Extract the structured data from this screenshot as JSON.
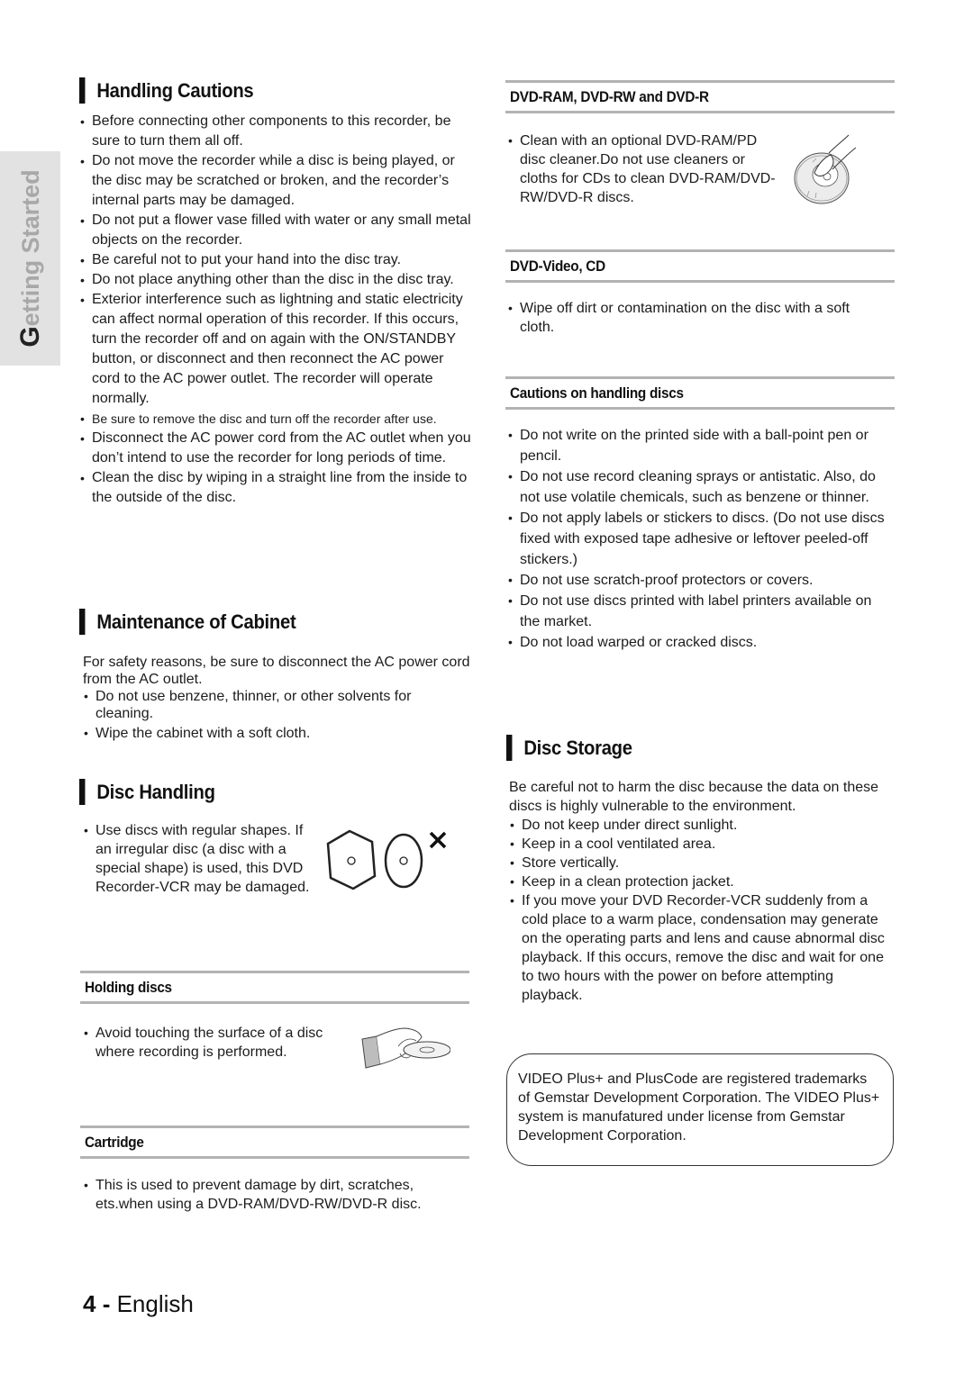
{
  "side_tab": {
    "initial": "G",
    "rest": "etting Started"
  },
  "left": {
    "handling_cautions": {
      "title": "Handling Cautions",
      "items": [
        "Before connecting other components to this recorder, be sure to turn them all off.",
        "Do not move the recorder while a disc is being played, or the disc may be scratched or broken, and the recorder’s internal parts may be damaged.",
        "Do not put a flower vase filled with water or any small metal objects on the recorder.",
        "Be careful not to put your hand into the disc tray.",
        "Do not place anything other than the disc in the disc tray.",
        "Exterior interference such as lightning and static electricity can affect normal operation of this recorder. If this occurs, turn the recorder off and on again with the ON/STANDBY button, or disconnect and then reconnect the AC power cord to the AC power outlet. The recorder will operate normally.",
        "Be sure to remove the disc and turn off the recorder after use.",
        "Disconnect the AC power cord from the AC outlet when you don’t intend to use the recorder for long periods of time.",
        "Clean the disc by wiping in a straight line from the inside to the outside of the disc."
      ]
    },
    "maintenance": {
      "title": "Maintenance of Cabinet",
      "intro": "For safety reasons, be sure to disconnect the AC power cord from the AC outlet.",
      "items": [
        "Do not use benzene, thinner, or other solvents for cleaning.",
        "Wipe the cabinet with a soft cloth."
      ]
    },
    "disc_handling": {
      "title": "Disc Handling",
      "item": "Use discs with regular shapes. If an irregular disc (a disc with a special shape) is used, this DVD Recorder-VCR may be damaged.",
      "illustration": [
        "hexagon-disc-icon",
        "oval-disc-icon",
        "not-allowed-x-icon"
      ]
    },
    "holding_discs": {
      "title": "Holding discs",
      "item": "Avoid touching the surface of a disc where recording is performed.",
      "illustration": "hand-holding-disc-icon"
    },
    "cartridge": {
      "title": "Cartridge",
      "item": "This is used to prevent damage by dirt, scratches, ets.when using a DVD-RAM/DVD-RW/DVD-R disc."
    }
  },
  "right": {
    "dvd_ram": {
      "title": "DVD-RAM, DVD-RW and DVD-R",
      "item": "Clean with an optional DVD-RAM/PD disc cleaner.Do not use cleaners or cloths for CDs to clean DVD-RAM/DVD-RW/DVD-R discs.",
      "illustration": "hand-cleaning-disc-icon"
    },
    "dvd_video": {
      "title": "DVD-Video, CD",
      "item": "Wipe off dirt or contamination on the disc with a soft cloth."
    },
    "cautions_discs": {
      "title": "Cautions on handling discs",
      "items": [
        "Do not write on the printed side with a ball-point pen or pencil.",
        "Do not use record cleaning sprays or antistatic. Also, do not use volatile chemicals, such as benzene or thinner.",
        "Do not apply labels or stickers to discs. (Do not use discs fixed with exposed tape adhesive or leftover peeled-off stickers.)",
        "Do not use scratch-proof protectors or covers.",
        "Do not use discs printed with label printers available on the market.",
        "Do not load warped or cracked discs."
      ]
    },
    "disc_storage": {
      "title": "Disc Storage",
      "intro": "Be careful not to harm the disc because the data on these discs is highly vulnerable to the environment.",
      "items": [
        "Do not keep under direct sunlight.",
        "Keep in a cool ventilated area.",
        "Store vertically.",
        "Keep in a clean protection jacket.",
        "If you move your DVD Recorder-VCR suddenly from a cold place to a warm place, condensation may generate on the operating parts and lens and cause abnormal disc playback. If this occurs, remove the disc and wait for one to two hours with the power on before attempting playback."
      ]
    },
    "trademark_note": "VIDEO Plus+ and PlusCode are registered trademarks of Gemstar Development Corporation. The VIDEO Plus+ system is manufatured under license from Gemstar Development Corporation."
  },
  "footer": {
    "page_number": "4",
    "separator": " - ",
    "language": "English"
  },
  "colors": {
    "rule": "#b3b3b3",
    "side_tab_bg": "#e2e2e2",
    "side_tab_text": "#a8a8a8"
  }
}
